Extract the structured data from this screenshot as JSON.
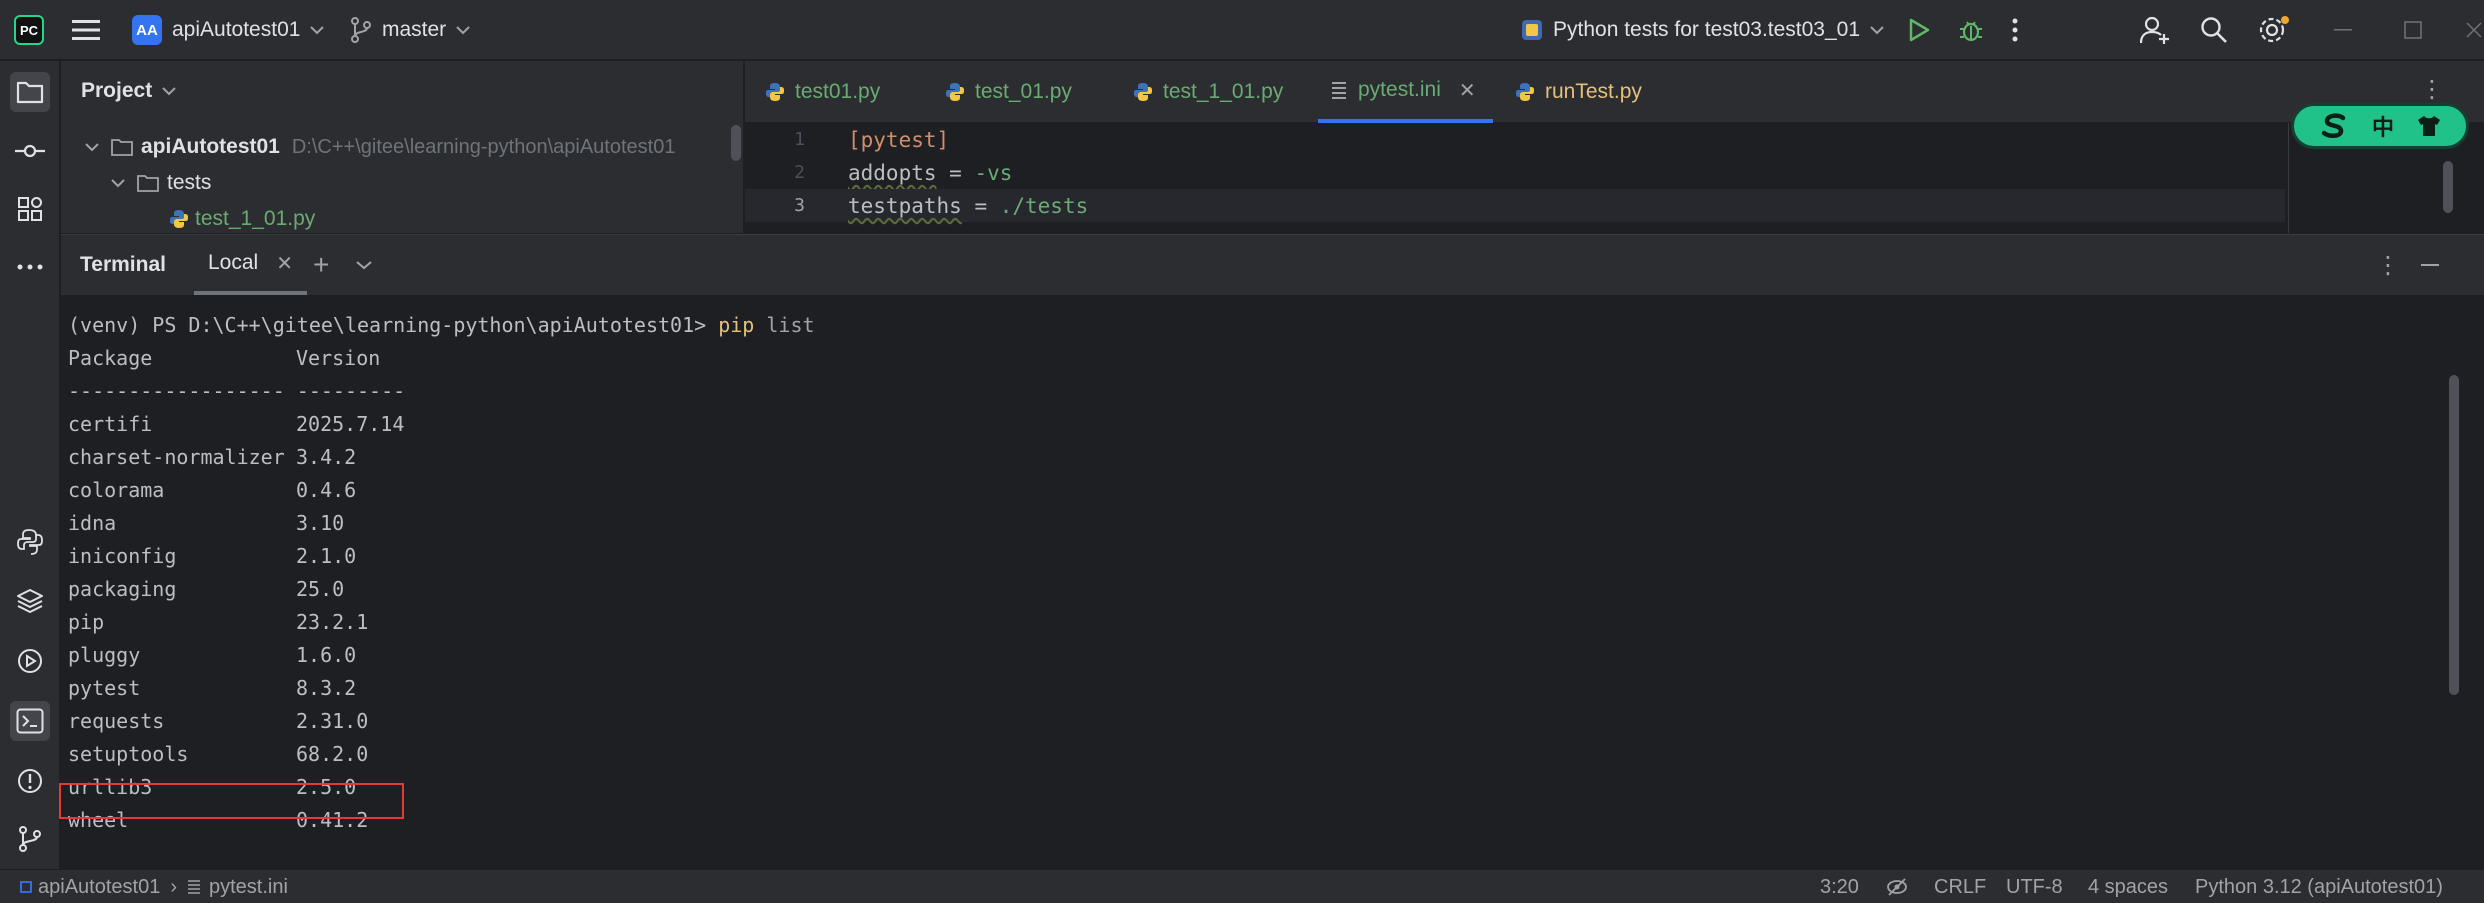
{
  "titlebar": {
    "project_badge": "AA",
    "project_name": "apiAutotest01",
    "branch": "master",
    "run_config": "Python tests for test03.test03_01"
  },
  "project_panel": {
    "title": "Project",
    "root_name": "apiAutotest01",
    "root_path": "D:\\C++\\gitee\\learning-python\\apiAutotest01",
    "folder": "tests",
    "file": "test_1_01.py"
  },
  "editor": {
    "tabs": [
      {
        "label": "test01.py",
        "icon": "python-file-icon"
      },
      {
        "label": "test_01.py",
        "icon": "python-file-icon"
      },
      {
        "label": "test_1_01.py",
        "icon": "python-file-icon"
      },
      {
        "label": "pytest.ini",
        "icon": "ini-file-icon",
        "active": true
      },
      {
        "label": "runTest.py",
        "icon": "python-file-icon"
      }
    ],
    "lines": [
      {
        "num": "1",
        "section": "[pytest]"
      },
      {
        "num": "2",
        "key": "addopts",
        "eq": " = ",
        "value": "-vs"
      },
      {
        "num": "3",
        "key": "testpaths",
        "eq": " = ",
        "value": "./tests"
      }
    ],
    "ime": {
      "char1": "中"
    }
  },
  "terminal": {
    "title": "Terminal",
    "tab_label": "Local",
    "prompt": "(venv) PS D:\\C++\\gitee\\learning-python\\apiAutotest01> ",
    "command": "pip",
    "command_arg": " list",
    "header_package": "Package",
    "header_version": "Version",
    "separator": "------------------ ---------",
    "packages": [
      {
        "name": "certifi",
        "version": "2025.7.14"
      },
      {
        "name": "charset-normalizer",
        "version": "3.4.2"
      },
      {
        "name": "colorama",
        "version": "0.4.6"
      },
      {
        "name": "idna",
        "version": "3.10"
      },
      {
        "name": "iniconfig",
        "version": "2.1.0"
      },
      {
        "name": "packaging",
        "version": "25.0"
      },
      {
        "name": "pip",
        "version": "23.2.1"
      },
      {
        "name": "pluggy",
        "version": "1.6.0"
      },
      {
        "name": "pytest",
        "version": "8.3.2"
      },
      {
        "name": "requests",
        "version": "2.31.0",
        "highlighted": true
      },
      {
        "name": "setuptools",
        "version": "68.2.0"
      },
      {
        "name": "urllib3",
        "version": "2.5.0"
      },
      {
        "name": "wheel",
        "version": "0.41.2"
      }
    ]
  },
  "statusbar": {
    "breadcrumb_project": "apiAutotest01",
    "breadcrumb_file": "pytest.ini",
    "position": "3:20",
    "line_ending": "CRLF",
    "encoding": "UTF-8",
    "indent": "4 spaces",
    "interpreter": "Python 3.12 (apiAutotest01)"
  },
  "colors": {
    "accent": "#3574f0",
    "highlight_box": "#e53935",
    "run_green": "#5fb865"
  }
}
